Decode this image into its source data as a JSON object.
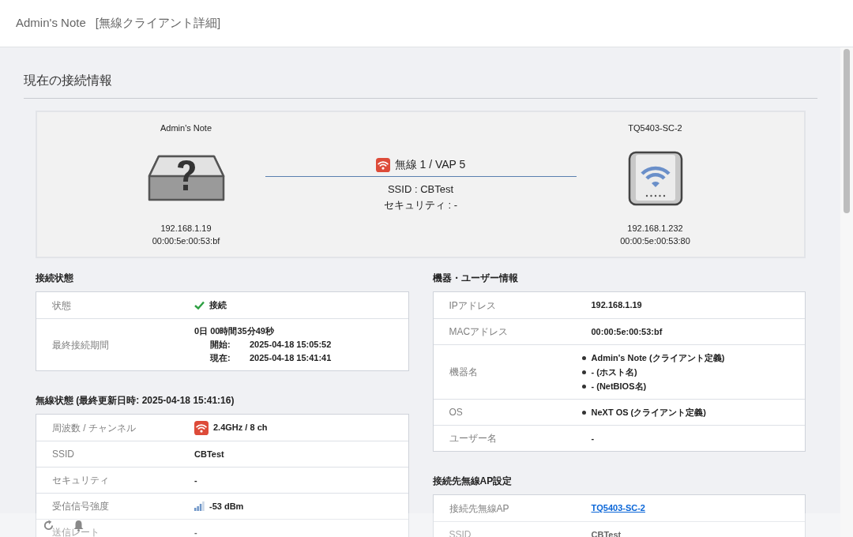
{
  "header": {
    "title": "Admin's Note",
    "subtitle": "[無線クライアント詳細]"
  },
  "section_title": "現在の接続情報",
  "diagram": {
    "client": {
      "name": "Admin's Note",
      "ip": "192.168.1.19",
      "mac": "00:00:5e:00:53:bf"
    },
    "link": {
      "label": "無線 1 / VAP 5",
      "ssid": "SSID : CBTest",
      "security": "セキュリティ : -"
    },
    "ap": {
      "name": "TQ5403-SC-2",
      "ip": "192.168.1.232",
      "mac": "00:00:5e:00:53:80"
    }
  },
  "columns": [
    [
      {
        "title": "接続状態",
        "rows": [
          {
            "kind": "status",
            "label": "状態",
            "value": "接続"
          },
          {
            "kind": "duration",
            "label": "最終接続期間",
            "value": "0日 00時間35分49秒",
            "details": [
              {
                "label": "開始:",
                "value": "2025-04-18 15:05:52"
              },
              {
                "label": "現在:",
                "value": "2025-04-18 15:41:41"
              }
            ]
          }
        ]
      },
      {
        "title": "無線状態 (最終更新日時: 2025-04-18 15:41:16)",
        "rows": [
          {
            "kind": "band",
            "label": "周波数 / チャンネル",
            "value": "2.4GHz / 8 ch"
          },
          {
            "kind": "text",
            "label": "SSID",
            "value": "CBTest"
          },
          {
            "kind": "text",
            "label": "セキュリティ",
            "value": "-"
          },
          {
            "kind": "signal",
            "label": "受信信号強度",
            "value": "-53 dBm"
          },
          {
            "kind": "text",
            "label": "送信レート",
            "value": "-"
          }
        ]
      }
    ],
    [
      {
        "title": "機器・ユーザー情報",
        "rows": [
          {
            "kind": "text",
            "label": "IPアドレス",
            "value": "192.168.1.19"
          },
          {
            "kind": "text",
            "label": "MACアドレス",
            "value": "00:00:5e:00:53:bf"
          },
          {
            "kind": "list",
            "label": "機器名",
            "items": [
              "Admin's Note (クライアント定義)",
              "- (ホスト名)",
              "- (NetBIOS名)"
            ]
          },
          {
            "kind": "list",
            "label": "OS",
            "items": [
              "NeXT OS (クライアント定義)"
            ]
          },
          {
            "kind": "text",
            "label": "ユーザー名",
            "value": "-"
          }
        ]
      },
      {
        "title": "接続先無線AP設定",
        "rows": [
          {
            "kind": "link",
            "label": "接続先無線AP",
            "value": "TQ5403-SC-2"
          },
          {
            "kind": "text",
            "label": "SSID",
            "value": "CBTest"
          }
        ]
      }
    ]
  ]
}
